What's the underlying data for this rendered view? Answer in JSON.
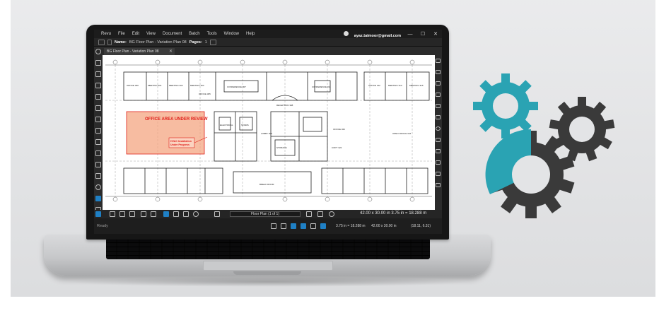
{
  "app": {
    "menu": [
      "Revu",
      "File",
      "Edit",
      "View",
      "Document",
      "Batch",
      "Tools",
      "Window",
      "Help"
    ],
    "account": "ayaz.taimoor@gmail.com",
    "window_buttons": [
      "—",
      "☐",
      "✕"
    ]
  },
  "properties_bar": {
    "name_label": "Name:",
    "name_value": "BG Floor Plan - Variation Plan 08",
    "pages_label": "Pages:",
    "pages_value": "1"
  },
  "tab": {
    "title": "BG Floor Plan - Variation Plan 08",
    "close": "✕"
  },
  "drawing": {
    "annotation_title": "OFFICE AREA UNDER REVIEW",
    "callout_line1": "HVAC Installation",
    "callout_line2": "Under Progress",
    "room_labels": [
      "OFFICE 300",
      "MEETING 301",
      "MEETING 302",
      "MEETING 303",
      "OFFICE 305",
      "CONFERENCE 307",
      "RECEPTION 308",
      "CONFERENCE 311",
      "OFFICE 312",
      "MEETING 313",
      "MEETING 315",
      "ELECTRICAL",
      "STAIRS",
      "LOBBY 309",
      "STORAGE",
      "COPY 322",
      "OPEN OFFICE 324",
      "OFFICE 326",
      "BREAK ROOM"
    ],
    "accent_fill": "#f4a582",
    "accent_red": "#e0201b"
  },
  "bottom_toolbar": {
    "page_nav": "Floor Plan (1 of 1)",
    "dims": "42.00 x 30.00 in    3.75 in = 18.288 m"
  },
  "status_bar": {
    "ready": "Ready",
    "scale": "3.75 in = 18.288 m",
    "size": "42.00 x 30.00 in",
    "coords": "(18.11, 6.31)"
  },
  "colors": {
    "gear_teal": "#2aa3b3",
    "gear_dark": "#3a3a3a",
    "revu_blue": "#1f80c5"
  }
}
